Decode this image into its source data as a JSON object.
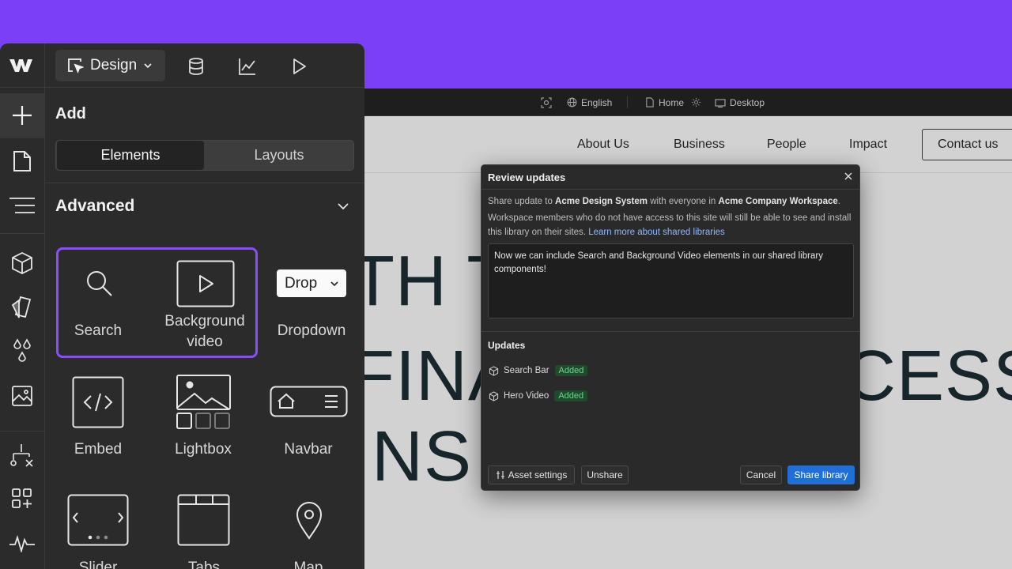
{
  "canvas_toolbar": {
    "language": "English",
    "page": "Home",
    "breakpoint": "Desktop"
  },
  "site": {
    "nav": [
      "About Us",
      "Business",
      "People",
      "Impact"
    ],
    "contact": "Contact us",
    "hero_lines": [
      "TH T",
      "FINA",
      "CESS",
      "INS"
    ]
  },
  "panel": {
    "mode": "Design",
    "add_title": "Add",
    "tabs": {
      "active": "Elements",
      "inactive": "Layouts"
    },
    "section": "Advanced",
    "dropdown_preview": "Drop",
    "elements": {
      "search": "Search",
      "bg_video_1": "Background",
      "bg_video_2": "video",
      "dropdown": "Dropdown",
      "embed": "Embed",
      "lightbox": "Lightbox",
      "navbar": "Navbar",
      "slider": "Slider",
      "tabs": "Tabs",
      "map": "Map"
    }
  },
  "modal": {
    "title": "Review updates",
    "share_prefix": "Share update to ",
    "library_name": "Acme Design System",
    "share_middle": " with everyone in ",
    "workspace_name": "Acme Company Workspace",
    "share_suffix": ".",
    "info": "Workspace members who do not have access to this site will still be able to see and install this library on their sites. ",
    "learn_more": "Learn more about shared libraries",
    "message": "Now we can include Search and Background Video elements in our shared library components!",
    "updates_label": "Updates",
    "updates": [
      {
        "name": "Search Bar",
        "status": "Added"
      },
      {
        "name": "Hero Video",
        "status": "Added"
      }
    ],
    "buttons": {
      "asset_settings": "Asset settings",
      "unshare": "Unshare",
      "cancel": "Cancel",
      "share": "Share library"
    }
  },
  "colors": {
    "background": "#7b3ff7",
    "panel": "#2b2b2b",
    "highlight": "#8a4cff",
    "primary_button": "#1f6fd6",
    "badge_text": "#6fd38f"
  }
}
